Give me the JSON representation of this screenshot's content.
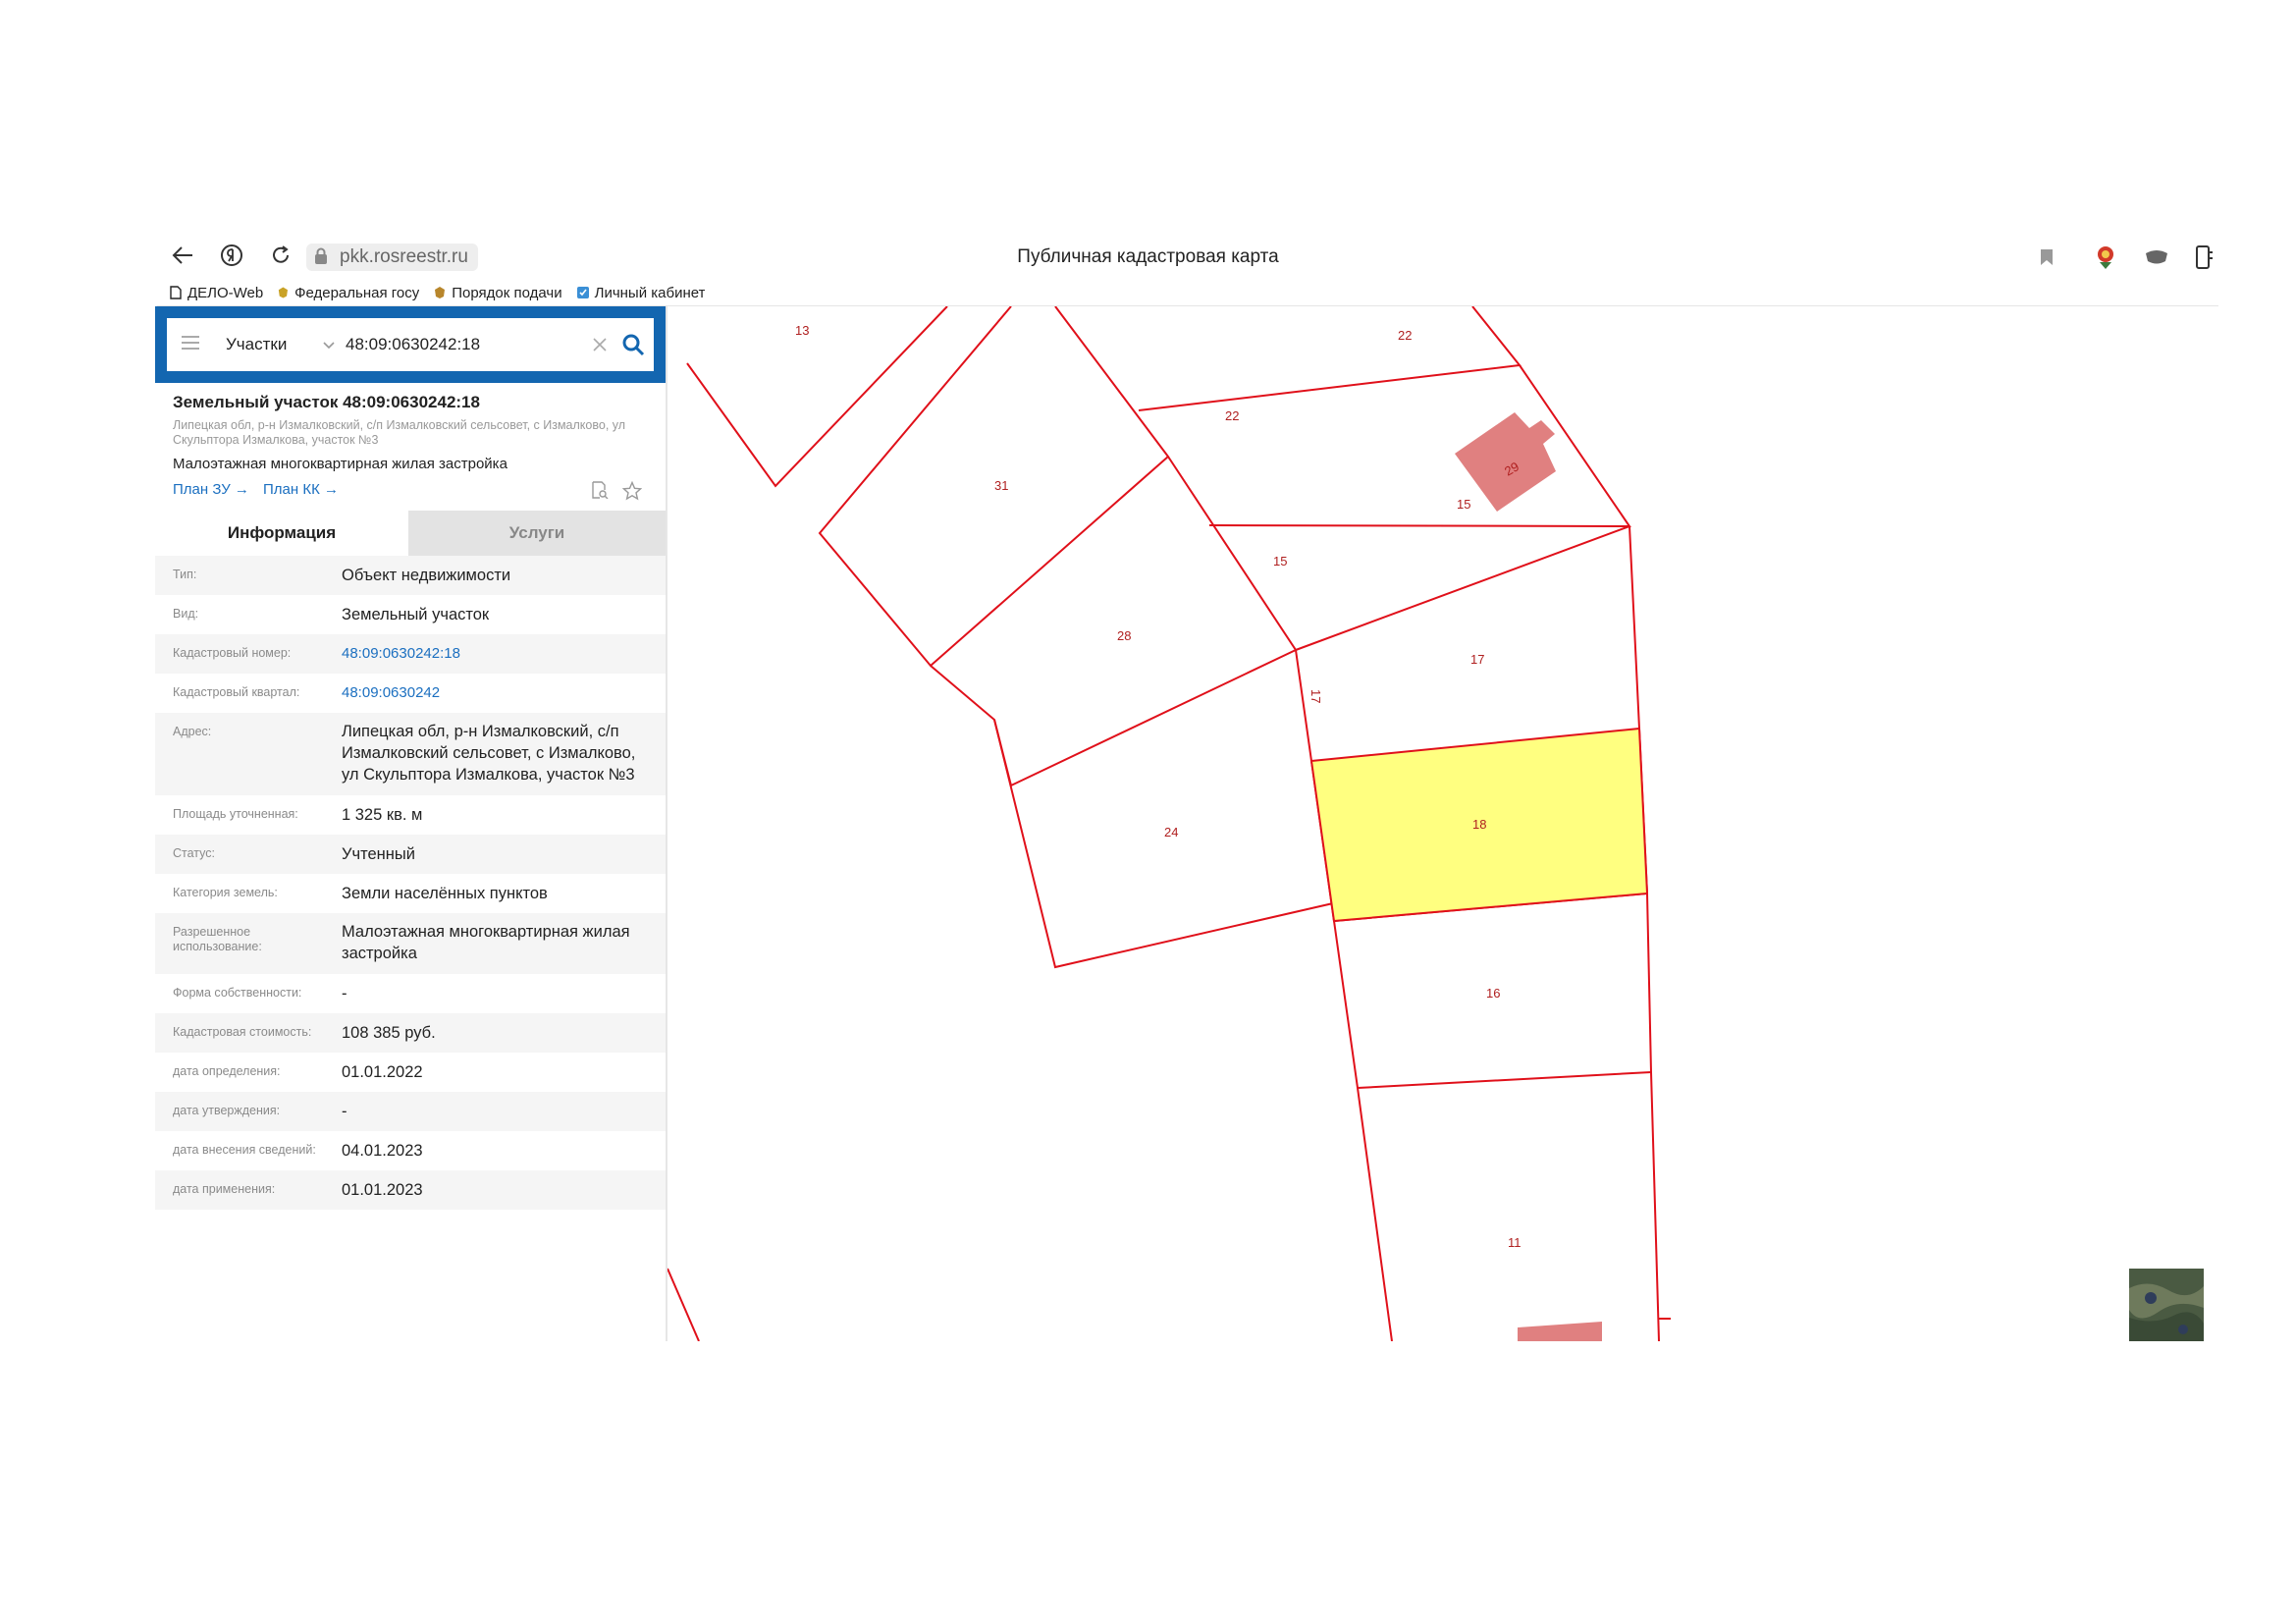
{
  "browser": {
    "url": "pkk.rosreestr.ru",
    "page_title": "Публичная кадастровая карта",
    "bookmarks": [
      "ДЕЛО-Web",
      "Федеральная госу",
      "Порядок подачи",
      "Личный кабинет"
    ]
  },
  "search": {
    "category": "Участки",
    "query": "48:09:0630242:18"
  },
  "object": {
    "title": "Земельный участок 48:09:0630242:18",
    "address_short": "Липецкая обл, р-н Измалковский, с/п Измалковский сельсовет, с Измалково, ул Скульптора Измалкова, участок №3",
    "use": "Малоэтажная многоквартирная жилая застройка",
    "link_plan_zu": "План ЗУ →",
    "link_plan_kk": "План КК →"
  },
  "tabs": {
    "info": "Информация",
    "services": "Услуги"
  },
  "attributes": [
    {
      "label": "Тип:",
      "value": "Объект недвижимости"
    },
    {
      "label": "Вид:",
      "value": "Земельный участок"
    },
    {
      "label": "Кадастровый номер:",
      "value": "48:09:0630242:18"
    },
    {
      "label": "Кадастровый квартал:",
      "value": "48:09:0630242"
    },
    {
      "label": "Адрес:",
      "value": "Липецкая обл, р-н Измалковский, с/п Измалковский сельсовет, с Измалково, ул Скульптора Измалкова, участок №3"
    },
    {
      "label": "Площадь уточненная:",
      "value": "1 325 кв. м"
    },
    {
      "label": "Статус:",
      "value": "Учтенный"
    },
    {
      "label": "Категория земель:",
      "value": "Земли населённых пунктов"
    },
    {
      "label": "Разрешенное использование:",
      "value": "Малоэтажная многоквартирная жилая застройка"
    },
    {
      "label": "Форма собственности:",
      "value": "-"
    },
    {
      "label": "Кадастровая стоимость:",
      "value": "108 385 руб."
    },
    {
      "label": "дата определения:",
      "value": "01.01.2022"
    },
    {
      "label": "дата утверждения:",
      "value": "-"
    },
    {
      "label": "дата внесения сведений:",
      "value": "04.01.2023"
    },
    {
      "label": "дата применения:",
      "value": "01.01.2023"
    }
  ],
  "map": {
    "parcel_labels": [
      "13",
      "22",
      "22",
      "31",
      "29",
      "15",
      "15",
      "28",
      "17",
      "17",
      "24",
      "18",
      "16",
      "11"
    ],
    "highlight_color": "#ffff80",
    "boundary_color": "#e0101a",
    "building_color": "#e08080"
  },
  "colors": {
    "header": "#1366b0",
    "link": "#1b6fc0"
  },
  "icons": [
    "back-icon",
    "yandex-icon",
    "reload-icon",
    "lock-icon",
    "bookmark-icon",
    "extension-icon",
    "menu-icon",
    "chevron-down-icon",
    "clear-icon",
    "search-icon",
    "star-icon",
    "doc-search-icon"
  ]
}
